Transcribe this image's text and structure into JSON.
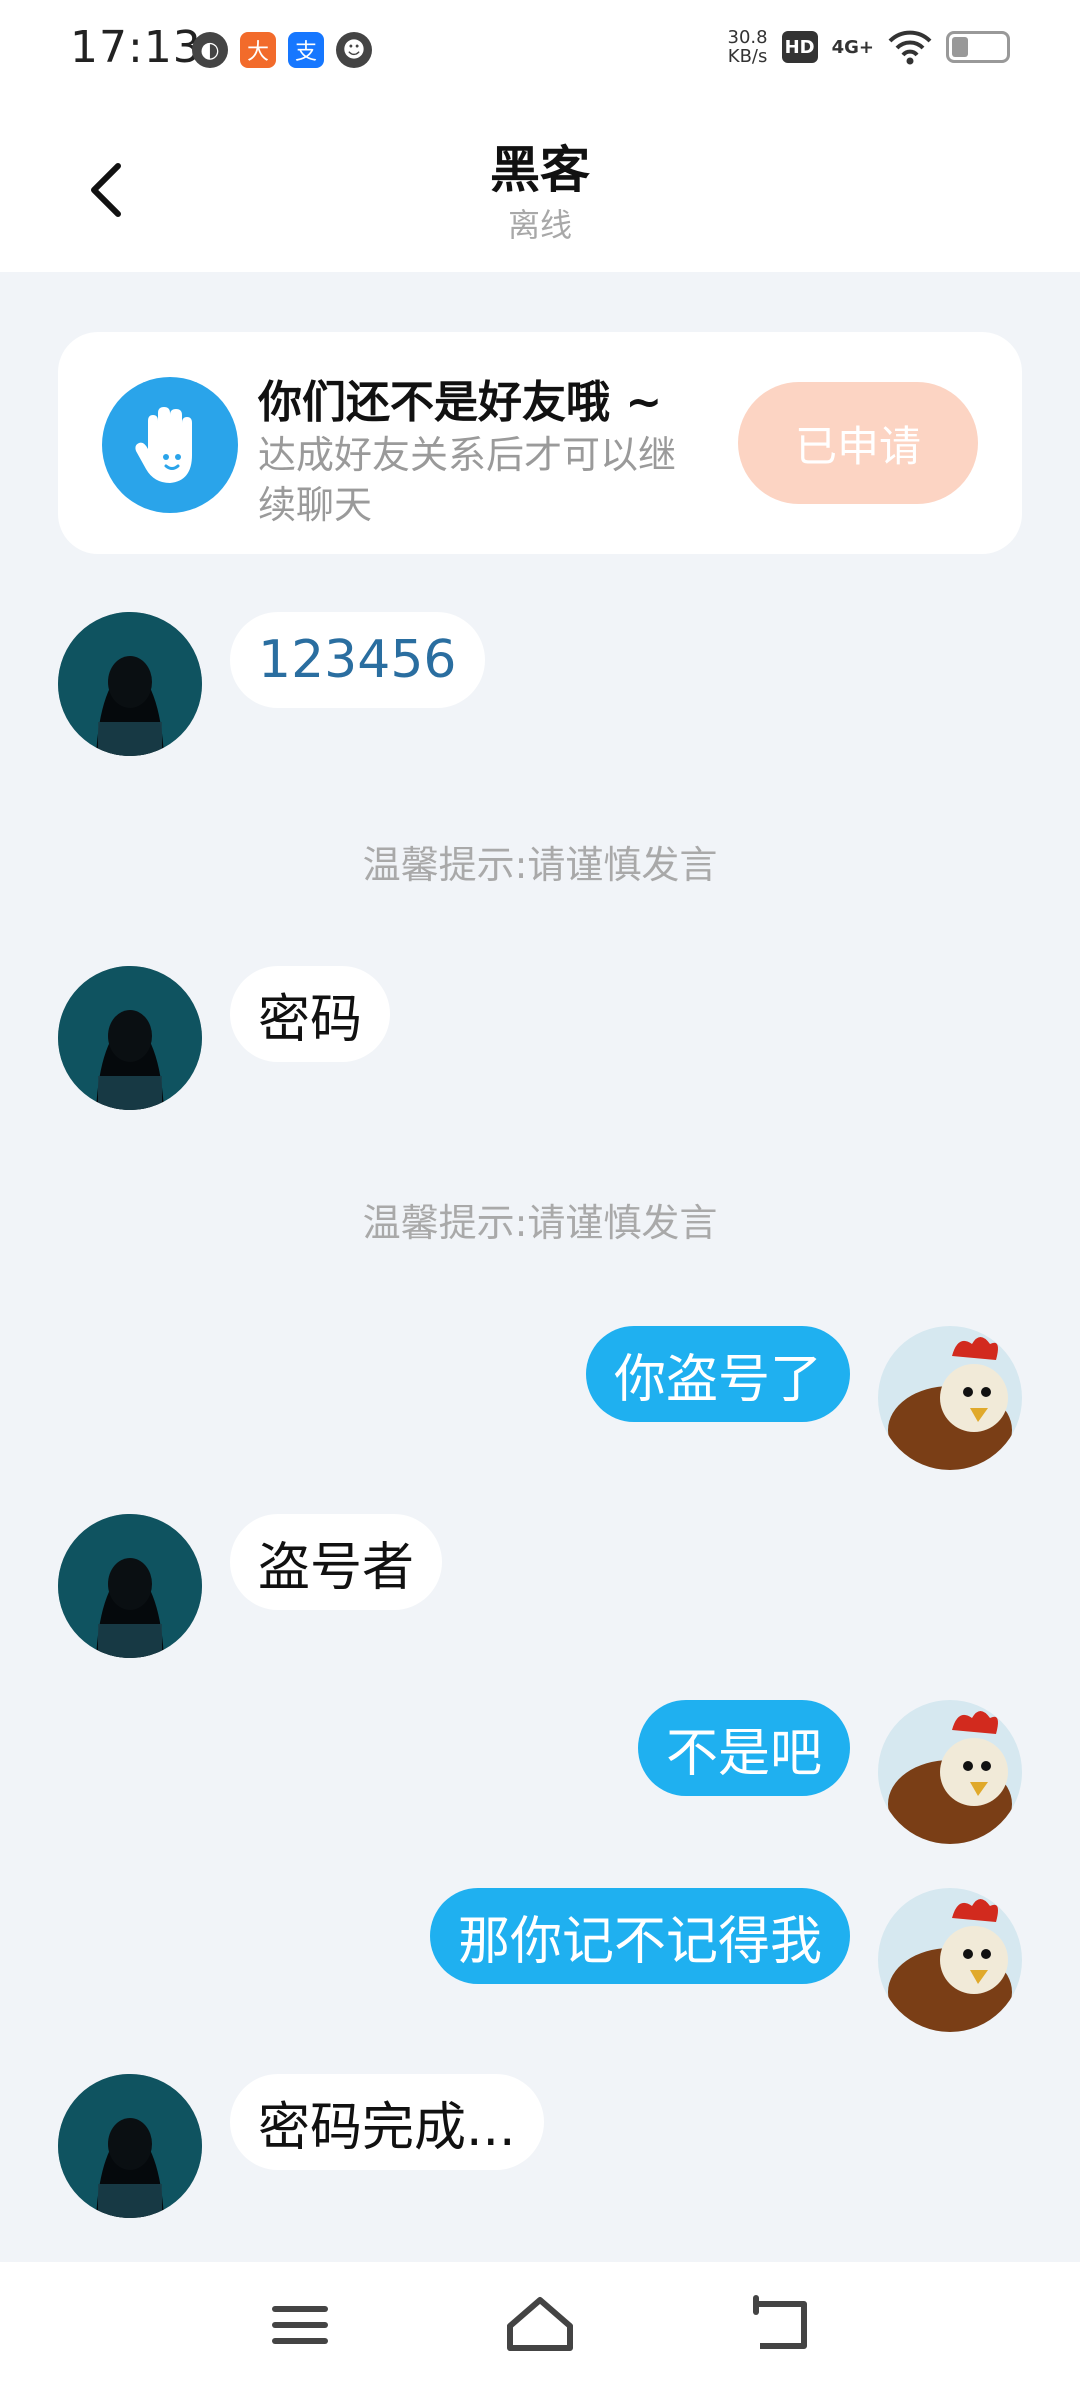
{
  "status_bar": {
    "time": "17:13",
    "speed_value": "30.8",
    "speed_unit": "KB/s",
    "hd": "HD",
    "network": "4G+",
    "app_icons": [
      "app-s-icon",
      "runner-app-icon",
      "alipay-icon",
      "cat-app-icon"
    ]
  },
  "header": {
    "title": "黑客",
    "status": "离线",
    "back_icon": "chevron-left-icon"
  },
  "friend_card": {
    "title": "你们还不是好友哦 ~",
    "description": "达成好友关系后才可以继续聊天",
    "button_label": "已申请",
    "icon": "hand-icon",
    "colors": {
      "icon_bg": "#2aa4ea",
      "button_bg": "#fcd4c3"
    }
  },
  "messages": [
    {
      "side": "in",
      "text": "123456"
    },
    {
      "side": "notice",
      "text": "温馨提示:请谨慎发言"
    },
    {
      "side": "in",
      "text": "密码"
    },
    {
      "side": "notice",
      "text": "温馨提示:请谨慎发言"
    },
    {
      "side": "out",
      "text": "你盗号了"
    },
    {
      "side": "in",
      "text": "盗号者"
    },
    {
      "side": "out",
      "text": "不是吧"
    },
    {
      "side": "out",
      "text": "那你记不记得我"
    },
    {
      "side": "in",
      "text": "密码完成..."
    }
  ],
  "colors": {
    "outgoing_bubble": "#1fb0f0",
    "incoming_number_text": "#2a6ea0",
    "background": "#f1f4f8"
  },
  "nav_bar": {
    "icons": [
      "menu-icon",
      "home-icon",
      "back-icon"
    ]
  }
}
